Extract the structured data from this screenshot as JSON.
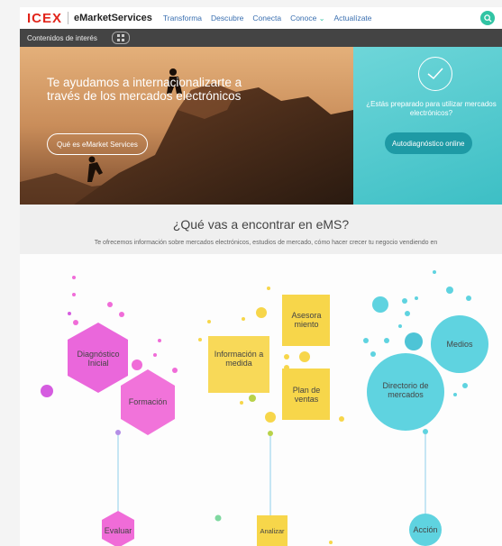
{
  "nav": {
    "logo_icex": "ICEX",
    "logo_ems": "eMarketServices",
    "links": [
      {
        "label": "Transforma"
      },
      {
        "label": "Descubre"
      },
      {
        "label": "Conecta"
      },
      {
        "label": "Conoce"
      },
      {
        "label": "Actualízate"
      }
    ]
  },
  "subbar": {
    "label": "Contenidos de interés"
  },
  "hero": {
    "title": "Te ayudamos a internacionalizarte a través de los mercados electrónicos",
    "button": "Qué es eMarket Services"
  },
  "cta": {
    "text": "¿Estás preparado para utilizar mercados electrónicos?",
    "button": "Autodiagnóstico online"
  },
  "section": {
    "title": "¿Qué vas a encontrar en eMS?",
    "desc": "Te ofrecemos información sobre mercados electrónicos, estudios de mercado, cómo hacer crecer tu negocio vendiendo en"
  },
  "infographic": {
    "evaluar": {
      "diagnostico": "Diagnóstico Inicial",
      "formacion": "Formación",
      "stage": "Evaluar"
    },
    "analizar": {
      "info": "Información a medida",
      "asesora": "Asesora miento",
      "plan": "Plan de ventas",
      "stage": "Analizar"
    },
    "accion": {
      "medios": "Medios",
      "directorio": "Directorio de mercados",
      "stage": "Acción"
    }
  },
  "colors": {
    "brand_red": "#e1251b",
    "accent": "#31c4a4",
    "hex_pink": "#f06cd8",
    "square_yellow": "#f7d64a",
    "circle_cyan": "#5fd3e0"
  }
}
